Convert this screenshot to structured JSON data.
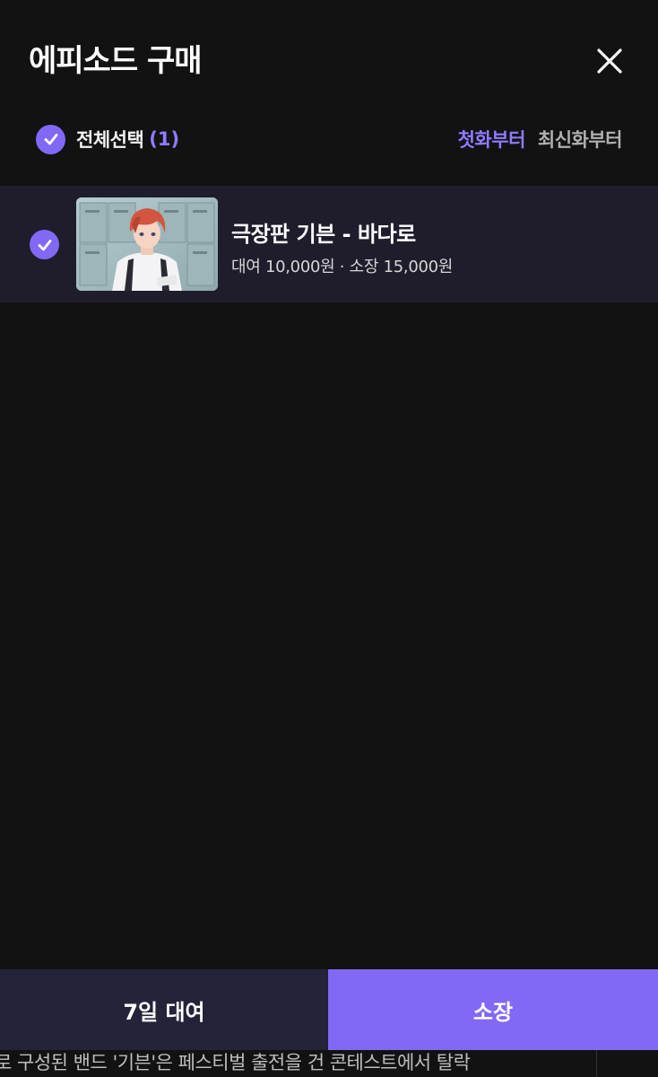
{
  "modal": {
    "title": "에피소드 구매",
    "close_icon": "close-icon"
  },
  "toolbar": {
    "select_all_label": "전체선택",
    "select_all_count": "(1)",
    "select_all_checked": true,
    "sort_options": [
      "첫화부터",
      "최신화부터"
    ],
    "sort_active": "첫화부터"
  },
  "episodes": [
    {
      "checked": true,
      "title": "극장판 기븐 - 바다로",
      "price": "대여 10,000원 · 소장 15,000원",
      "thumbnail_icon": "episode-thumbnail"
    }
  ],
  "actions": {
    "rent_label": "7일 대여",
    "own_label": "소장"
  },
  "background_text": "로 구성된 밴드 '기븐'은 페스티벌 출전을 건 콘테스트에서 탈락",
  "colors": {
    "accent": "#8169f5",
    "accent_text": "#8f7cff",
    "background": "#121212",
    "row_highlight": "#1f1d2c",
    "rent_button": "#23233a"
  }
}
